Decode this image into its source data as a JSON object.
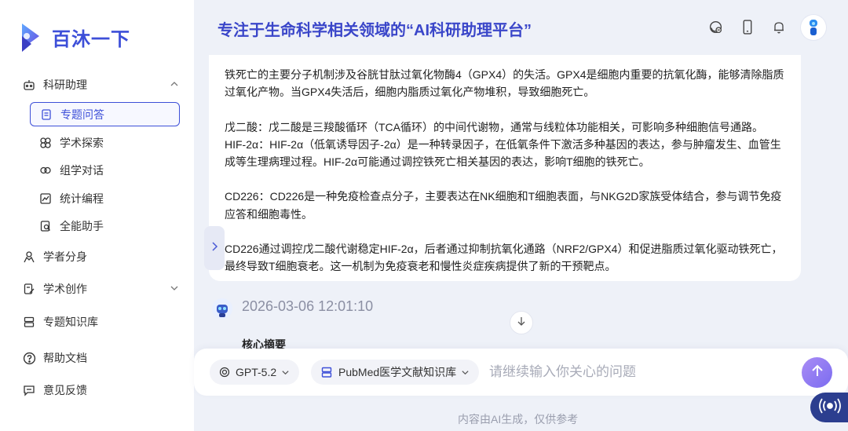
{
  "brand": {
    "name": "百沐一下"
  },
  "header": {
    "title": "专注于生命科学相关领域的“AI科研助理平台”"
  },
  "sidebar": {
    "research_group": "科研助理",
    "sub_items": [
      {
        "label": "专题问答",
        "icon": "document-list-icon",
        "active": true
      },
      {
        "label": "学术探索",
        "icon": "compass-icon"
      },
      {
        "label": "组学对话",
        "icon": "link-chat-icon"
      },
      {
        "label": "统计编程",
        "icon": "chart-icon"
      },
      {
        "label": "全能助手",
        "icon": "search-doc-icon"
      }
    ],
    "scholar_avatar": "学者分身",
    "academic_creation": "学术创作",
    "knowledge_base": "专题知识库",
    "help_docs": "帮助文档",
    "feedback": "意见反馈"
  },
  "answer": {
    "paragraphs": [
      "铁死亡的主要分子机制涉及谷胱甘肽过氧化物酶4（GPX4）的失活。GPX4是细胞内重要的抗氧化酶，能够清除脂质过氧化产物。当GPX4失活后，细胞内脂质过氧化产物堆积，导致细胞死亡。",
      "",
      "戊二酸：戊二酸是三羧酸循环（TCA循环）的中间代谢物，通常与线粒体功能相关，可影响多种细胞信号通路。",
      "HIF-2α：HIF-2α（低氧诱导因子-2α）是一种转录因子，在低氧条件下激活多种基因的表达，参与肿瘤发生、血管生成等生理病理过程。HIF-2α可能通过调控铁死亡相关基因的表达，影响T细胞的铁死亡。",
      "",
      "CD226：CD226是一种免疫检查点分子，主要表达在NK细胞和T细胞表面，与NKG2D家族受体结合，参与调节免疫应答和细胞毒性。",
      "",
      "CD226通过调控戊二酸代谢稳定HIF-2α，后者通过抑制抗氧化通路（NRF2/GPX4）和促进脂质过氧化驱动铁死亡，最终导致T细胞衰老。这一机制为免疫衰老和慢性炎症疾病提供了新的干预靶点。"
    ]
  },
  "message": {
    "timestamp": "2026-03-06 12:01:10",
    "section_title": "核心摘要"
  },
  "input": {
    "model": "GPT-5.2",
    "knowledge_base": "PubMed医学文献知识库",
    "placeholder": "请继续输入你关心的问题"
  },
  "footer": {
    "disclaimer": "内容由AI生成，仅供参考"
  },
  "colors": {
    "accent": "#3d4fd8",
    "send_gradient": "#8d7cf2",
    "voice": "#2c3e8f"
  }
}
